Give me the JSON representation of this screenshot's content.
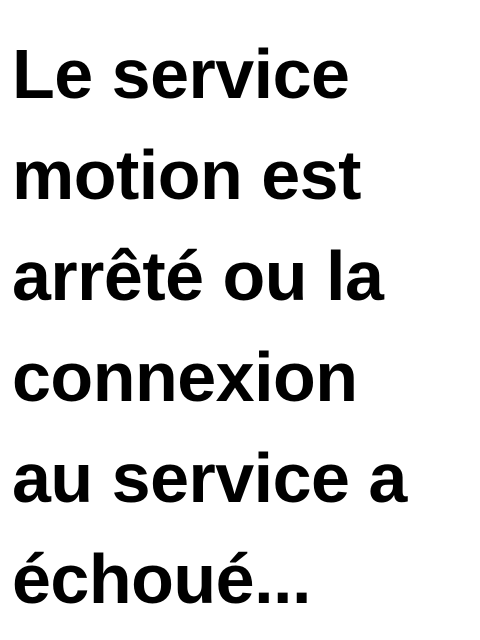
{
  "message": {
    "text": "Le service\nmotion est\narrêté ou la\nconnexion\nau service a\néchoué..."
  },
  "colors": {
    "background": "#ffffff",
    "text": "#000000"
  }
}
